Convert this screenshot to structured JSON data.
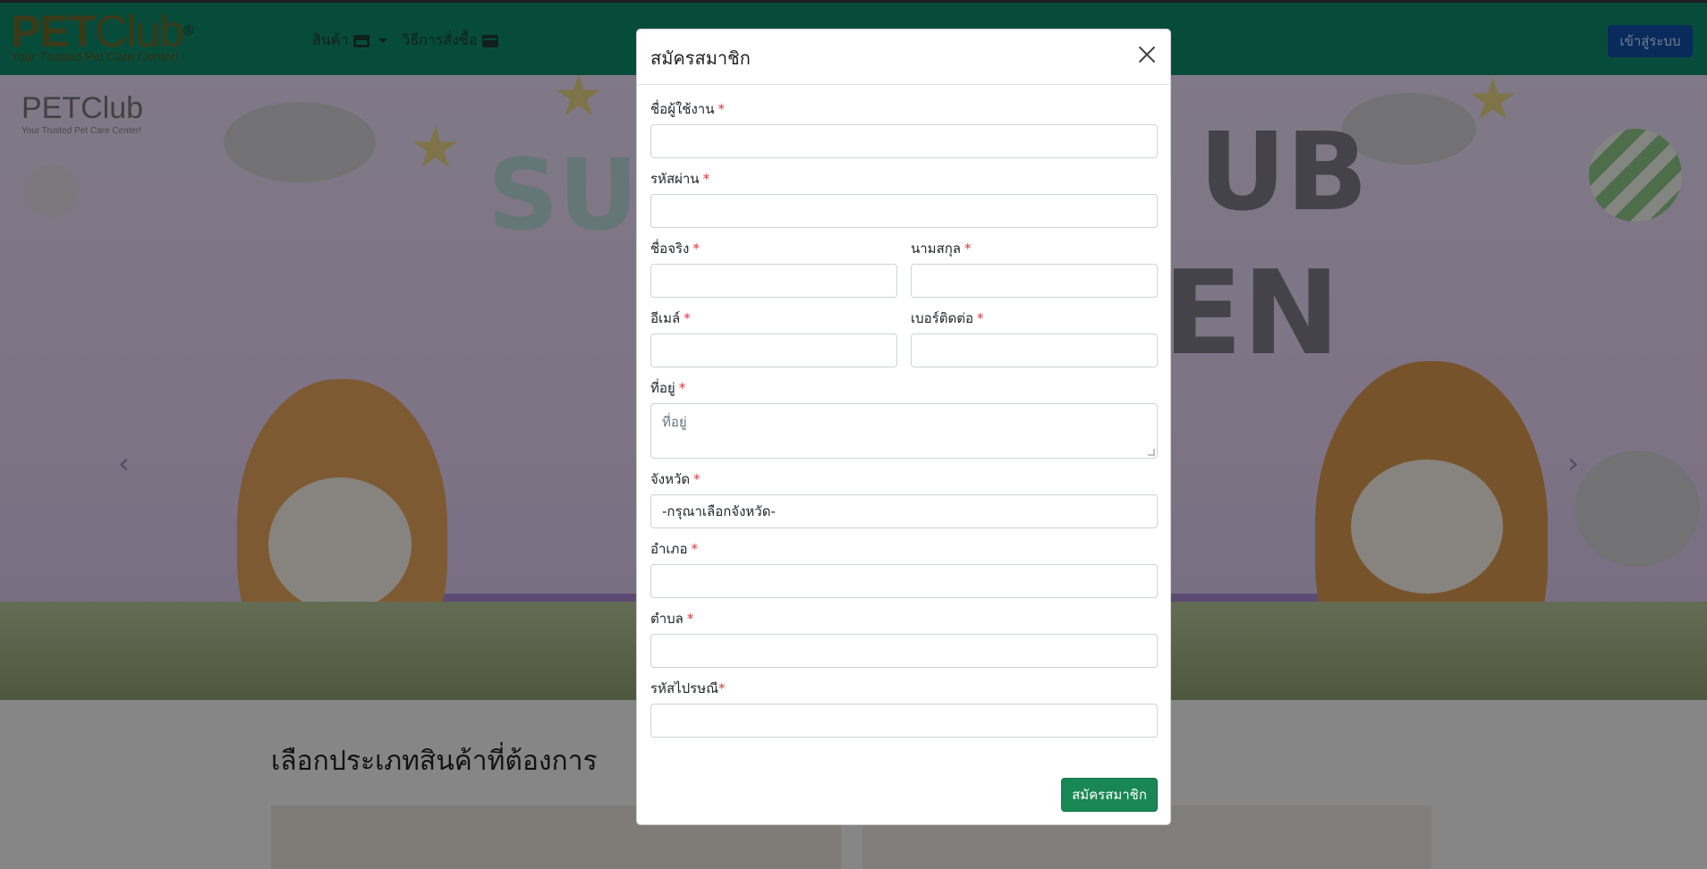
{
  "navbar": {
    "logo_main": "PET",
    "logo_club": "Club",
    "logo_reg": "®",
    "logo_tagline": "Your Trusted Pet Care Center!",
    "menu": [
      {
        "label": "สินค้า",
        "icon": "store-icon",
        "has_dropdown": true
      },
      {
        "label": "วิธีการสั่งซื้อ",
        "icon": "credit-card-icon",
        "has_dropdown": false
      }
    ],
    "login_label": "เข้าสู่ระบบ"
  },
  "hero": {
    "logo_main": "PETClub",
    "logo_tagline": "Your Trusted Pet Care Center!",
    "prev_icon": "chevron-left-icon",
    "next_icon": "chevron-right-icon"
  },
  "section": {
    "title": "เลือกประเภทสินค้าที่ต้องการ"
  },
  "modal": {
    "title": "สมัครสมาชิก",
    "close_icon": "close-icon",
    "fields": {
      "username": {
        "label": "ชื่อผู้ใช้งาน",
        "value": ""
      },
      "password": {
        "label": "รหัสผ่าน",
        "value": ""
      },
      "first_name": {
        "label": "ชื่อจริง",
        "value": ""
      },
      "last_name": {
        "label": "นามสกุล",
        "value": ""
      },
      "email": {
        "label": "อีเมล์",
        "value": ""
      },
      "phone": {
        "label": "เบอร์ติดต่อ",
        "value": ""
      },
      "address": {
        "label": "ที่อยู่",
        "placeholder": "ที่อยู่",
        "value": ""
      },
      "province": {
        "label": "จังหวัด",
        "selected": "-กรุณาเลือกจังหวัด-"
      },
      "district": {
        "label": "อำเภอ",
        "value": ""
      },
      "subdistrict": {
        "label": "ตำบล",
        "value": ""
      },
      "postcode": {
        "label": "รหัสไปรษณี",
        "value": ""
      }
    },
    "required_mark": "*",
    "submit_label": "สมัครสมาชิก"
  },
  "colors": {
    "navbar": "#0d8a6a",
    "login_button": "#0f4fa8",
    "submit_button": "#198754",
    "required": "#dc3545"
  }
}
